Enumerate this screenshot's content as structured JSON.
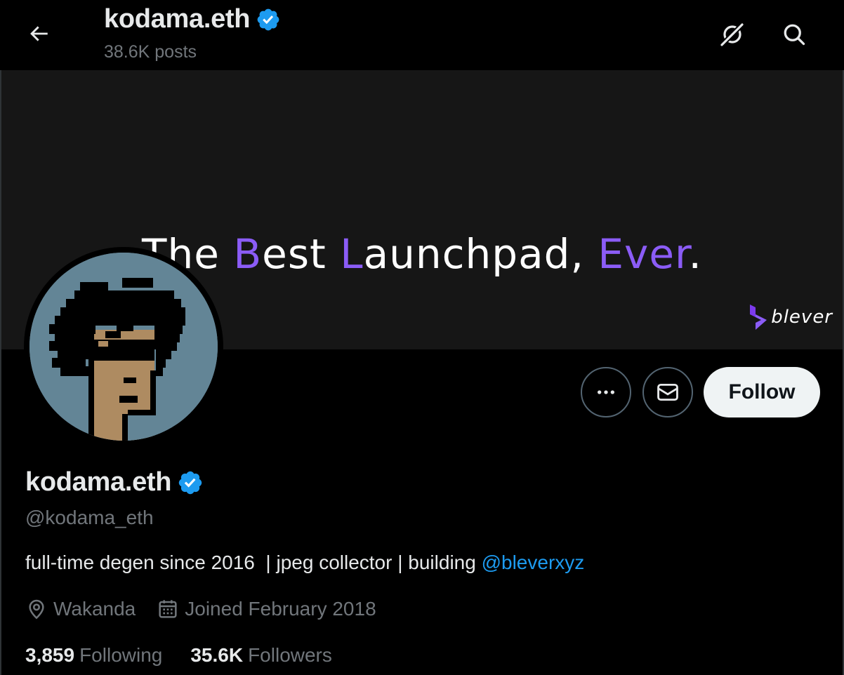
{
  "header": {
    "title": "kodama.eth",
    "posts": "38.6K posts"
  },
  "banner": {
    "headline_parts": [
      "The ",
      "B",
      "est ",
      "L",
      "aunchpad, ",
      "Ev",
      "er",
      "."
    ],
    "logo_text": "blever",
    "accent_color": "#8b5cf6"
  },
  "profile": {
    "name": "kodama.eth",
    "handle": "@kodama_eth",
    "bio_text": "full-time degen since 2016  | jpeg collector | building ",
    "bio_link": "@bleverxyz",
    "location": "Wakanda",
    "joined": "Joined February 2018",
    "following_count": "3,859",
    "following_label": "Following",
    "followers_count": "35.6K",
    "followers_label": "Followers"
  },
  "actions": {
    "follow_label": "Follow"
  },
  "icons": {
    "back": "arrow-left-icon",
    "grok": "grok-icon",
    "search": "search-icon",
    "verified": "verified-badge-icon",
    "more": "more-icon",
    "message": "mail-icon",
    "location": "location-pin-icon",
    "calendar": "calendar-icon"
  },
  "colors": {
    "background": "#000000",
    "verified": "#1d9bf0",
    "link": "#1d9bf0",
    "secondary_text": "#71767b",
    "avatar_bg": "#638596"
  }
}
